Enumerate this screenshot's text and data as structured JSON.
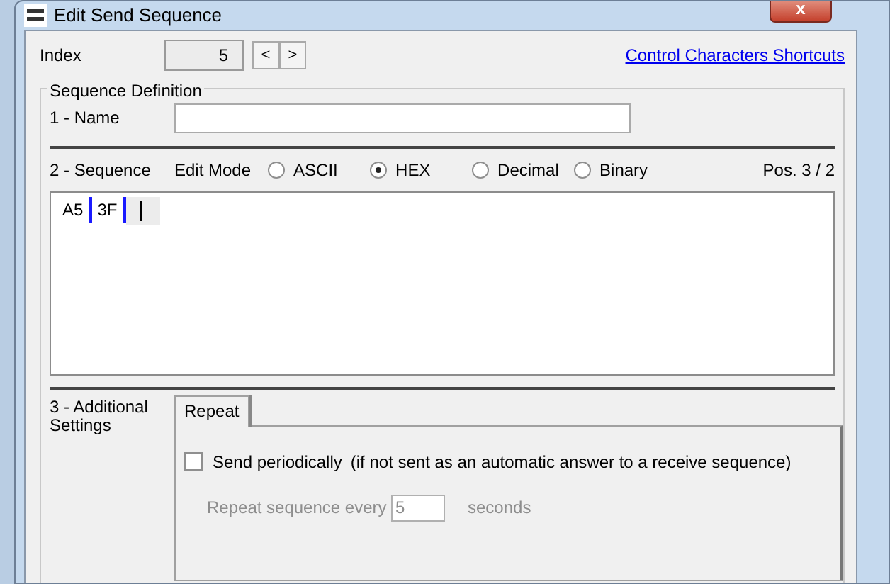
{
  "window": {
    "title": "Edit Send Sequence",
    "close": "x"
  },
  "index": {
    "label": "Index",
    "value": "5",
    "prev": "<",
    "next": ">"
  },
  "shortcuts_link": "Control Characters Shortcuts",
  "group": {
    "title": "Sequence Definition"
  },
  "name": {
    "label": "1 - Name"
  },
  "sequence": {
    "label": "2 - Sequence",
    "edit_mode_label": "Edit Mode",
    "position": "Pos. 3 / 2",
    "modes": [
      {
        "label": "ASCII",
        "selected": false
      },
      {
        "label": "HEX",
        "selected": true
      },
      {
        "label": "Decimal",
        "selected": false
      },
      {
        "label": "Binary",
        "selected": false
      }
    ],
    "bytes": [
      "A5",
      "3F"
    ]
  },
  "additional": {
    "label": "3 - Additional Settings",
    "tabs": [
      {
        "label": "Repeat",
        "selected": true
      }
    ],
    "send_periodically": {
      "label": "Send periodically",
      "note": "(if not sent as an automatic answer to a receive sequence)",
      "checked": false
    },
    "repeat": {
      "label": "Repeat sequence every",
      "value": "5",
      "unit": "seconds",
      "disabled": true
    }
  }
}
